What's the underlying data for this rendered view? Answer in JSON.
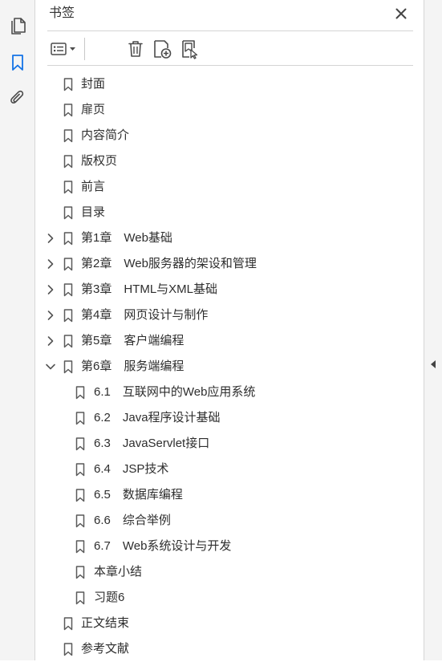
{
  "panel": {
    "title": "书签"
  },
  "toolbar": {
    "buttons": [
      {
        "name": "options-menu",
        "icon": "list-options-icon"
      },
      {
        "name": "delete-bookmark",
        "icon": "trash-icon"
      },
      {
        "name": "new-bookmark",
        "icon": "new-bookmark-icon"
      },
      {
        "name": "find-current-bookmark",
        "icon": "find-bookmark-icon"
      }
    ]
  },
  "side_tools": [
    {
      "name": "page-thumbnails",
      "icon": "pages-icon"
    },
    {
      "name": "bookmarks",
      "icon": "bookmark-icon",
      "active": true
    },
    {
      "name": "attachments",
      "icon": "paperclip-icon"
    }
  ],
  "colors": {
    "accent": "#1473e6",
    "icon": "#4b4b4b",
    "text": "#2e2e2e"
  },
  "bookmarks": [
    {
      "label": "封面",
      "level": 1,
      "expander": "none"
    },
    {
      "label": "扉页",
      "level": 1,
      "expander": "none"
    },
    {
      "label": "内容简介",
      "level": 1,
      "expander": "none"
    },
    {
      "label": "版权页",
      "level": 1,
      "expander": "none"
    },
    {
      "label": "前言",
      "level": 1,
      "expander": "none"
    },
    {
      "label": "目录",
      "level": 1,
      "expander": "none"
    },
    {
      "label": "第1章　Web基础",
      "level": 1,
      "expander": "collapsed"
    },
    {
      "label": "第2章　Web服务器的架设和管理",
      "level": 1,
      "expander": "collapsed"
    },
    {
      "label": "第3章　HTML与XML基础",
      "level": 1,
      "expander": "collapsed"
    },
    {
      "label": "第4章　网页设计与制作",
      "level": 1,
      "expander": "collapsed"
    },
    {
      "label": "第5章　客户端编程",
      "level": 1,
      "expander": "collapsed"
    },
    {
      "label": "第6章　服务端编程",
      "level": 1,
      "expander": "expanded"
    },
    {
      "label": "6.1　互联网中的Web应用系统",
      "level": 2,
      "expander": "none"
    },
    {
      "label": "6.2　Java程序设计基础",
      "level": 2,
      "expander": "none"
    },
    {
      "label": "6.3　JavaServlet接口",
      "level": 2,
      "expander": "none"
    },
    {
      "label": "6.4　JSP技术",
      "level": 2,
      "expander": "none"
    },
    {
      "label": "6.5　数据库编程",
      "level": 2,
      "expander": "none"
    },
    {
      "label": "6.6　综合举例",
      "level": 2,
      "expander": "none"
    },
    {
      "label": "6.7　Web系统设计与开发",
      "level": 2,
      "expander": "none"
    },
    {
      "label": "本章小结",
      "level": 2,
      "expander": "none"
    },
    {
      "label": "习题6",
      "level": 2,
      "expander": "none"
    },
    {
      "label": "正文结束",
      "level": 1,
      "expander": "none"
    },
    {
      "label": "参考文献",
      "level": 1,
      "expander": "none"
    }
  ]
}
